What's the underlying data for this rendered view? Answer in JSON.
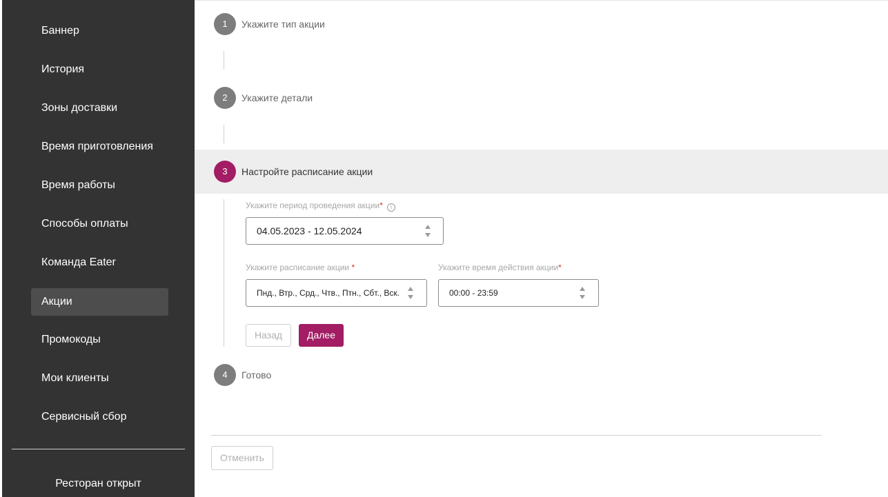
{
  "sidebar": {
    "items": [
      {
        "label": "Баннер",
        "active": false
      },
      {
        "label": "История",
        "active": false
      },
      {
        "label": "Зоны доставки",
        "active": false
      },
      {
        "label": "Время приготовления",
        "active": false
      },
      {
        "label": "Время работы",
        "active": false
      },
      {
        "label": "Способы оплаты",
        "active": false
      },
      {
        "label": "Команда Eater",
        "active": false
      },
      {
        "label": "Акции",
        "active": true
      },
      {
        "label": "Промокоды",
        "active": false
      },
      {
        "label": "Мои клиенты",
        "active": false
      },
      {
        "label": "Сервисный сбор",
        "active": false
      }
    ],
    "status_text": "Ресторан открыт"
  },
  "steps": [
    {
      "number": "1",
      "label": "Укажите тип акции",
      "active": false
    },
    {
      "number": "2",
      "label": "Укажите детали",
      "active": false
    },
    {
      "number": "3",
      "label": "Настройте расписание акции",
      "active": true
    },
    {
      "number": "4",
      "label": "Готово",
      "active": false
    }
  ],
  "schedule_form": {
    "period_label": "Укажите период проведения акции",
    "period_required": "*",
    "period_value": "04.05.2023 - 12.05.2024",
    "days_label": "Укажите расписание акции ",
    "days_required": "*",
    "days_value": "Пнд., Втр., Срд., Чтв., Птн., Сбт., Вск.",
    "time_label": "Укажите время действия акции",
    "time_required": "*",
    "time_value": "00:00 - 23:59",
    "back_label": "Назад",
    "next_label": "Далее"
  },
  "footer": {
    "cancel_label": "Отменить"
  },
  "colors": {
    "sidebar_bg": "#333333",
    "sidebar_active_bg": "#4d4d4d",
    "accent": "#a21d64",
    "inactive_step": "#7d7d7d"
  }
}
